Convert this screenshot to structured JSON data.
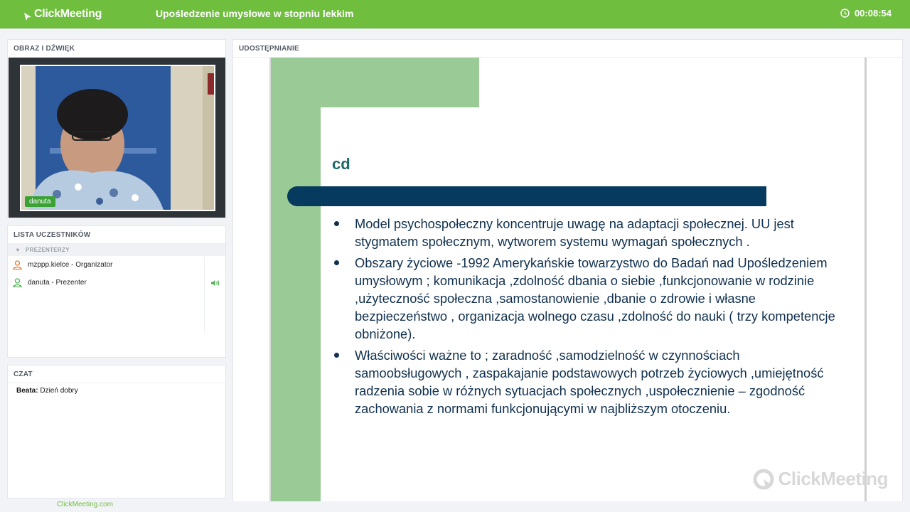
{
  "header": {
    "brand": "ClickMeeting",
    "meeting_title": "Upośledzenie umysłowe w stopniu lekkim",
    "timer": "00:08:54"
  },
  "video": {
    "heading": "OBRAZ I DŹWIĘK",
    "speaker_name": "danuta"
  },
  "participants": {
    "heading": "LISTA UCZESTNIKÓW",
    "group_label": "PREZENTERZY",
    "items": [
      {
        "label": "mzppp.kielce - Organizator",
        "icon": "user-icon",
        "color": "#e07a2e"
      },
      {
        "label": "danuta - Prezenter",
        "icon": "user-icon",
        "color": "#4caf50"
      }
    ]
  },
  "chat": {
    "heading": "CZAT",
    "messages": [
      {
        "author": "Beata:",
        "text": "Dzień dobry"
      }
    ]
  },
  "footer": {
    "link": "ClickMeeting.com"
  },
  "share": {
    "heading": "UDOSTĘPNIANIE",
    "slide_title": "cd",
    "bullets": [
      "Model psychospołeczny koncentruje uwagę na adaptacji społecznej. UU jest stygmatem społecznym, wytworem systemu wymagań społecznych .",
      "Obszary życiowe  -1992 Amerykańskie towarzystwo do Badań nad Upośledzeniem umysłowym ; komunikacja ,zdolność dbania o siebie ,funkcjonowanie w rodzinie ,użyteczność społeczna ,samostanowienie ,dbanie o zdrowie i własne bezpieczeństwo , organizacja wolnego czasu ,zdolność do nauki  ( trzy kompetencje obniżone).",
      "Właściwości ważne to ; zaradność ,samodzielność w czynnościach samoobsługowych , zaspakajanie podstawowych potrzeb życiowych ,umiejętność radzenia sobie w różnych sytuacjach społecznych ,uspołecznienie – zgodność zachowania z normami funkcjonującymi w najbliższym otoczeniu."
    ],
    "watermark": "ClickMeeting"
  },
  "colors": {
    "brand_green": "#6fbe3e",
    "slide_green": "#9acb96",
    "slide_blue": "#063a5e"
  }
}
